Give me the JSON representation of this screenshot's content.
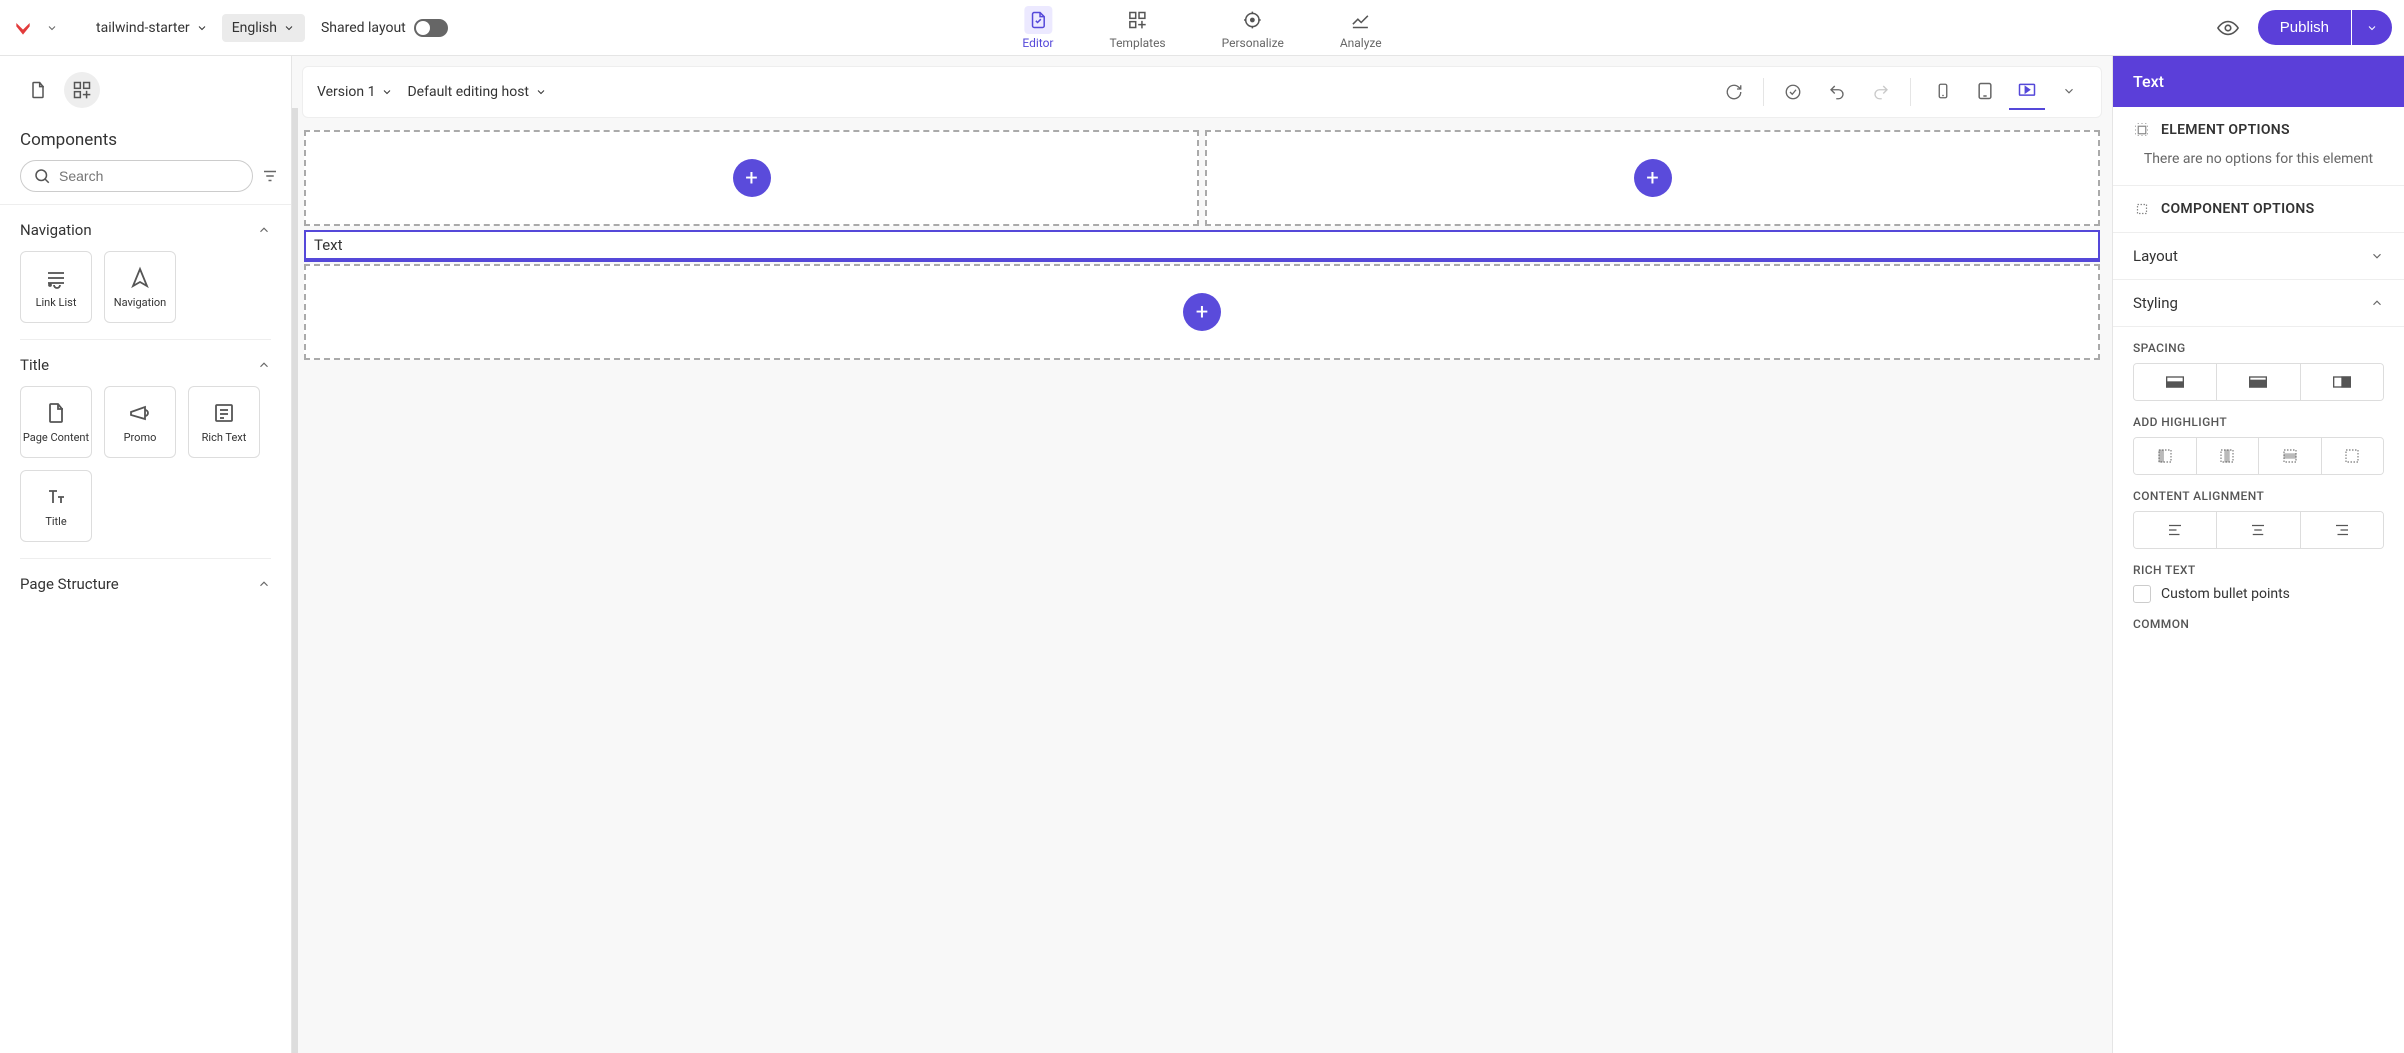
{
  "topbar": {
    "project": "tailwind-starter",
    "language": "English",
    "shared_label": "Shared layout",
    "nav": {
      "editor": "Editor",
      "templates": "Templates",
      "personalize": "Personalize",
      "analyze": "Analyze"
    },
    "publish": "Publish"
  },
  "left": {
    "title": "Components",
    "search_placeholder": "Search",
    "groups": {
      "navigation": {
        "title": "Navigation",
        "link_list": "Link List",
        "navigation": "Navigation"
      },
      "page_content": {
        "title": "Title",
        "page_content": "Page Content",
        "promo": "Promo",
        "rich_text": "Rich Text"
      },
      "page_structure": {
        "title": "Page Structure"
      }
    }
  },
  "canvas": {
    "version": "Version 1",
    "host": "Default editing host",
    "selected_text": "Text"
  },
  "right": {
    "header": "Text",
    "element_options": "ELEMENT OPTIONS",
    "element_empty": "There are no options for this element",
    "component_options": "COMPONENT OPTIONS",
    "layout": "Layout",
    "styling": "Styling",
    "spacing": "SPACING",
    "add_highlight": "ADD HIGHLIGHT",
    "content_alignment": "CONTENT ALIGNMENT",
    "rich_text": "RICH TEXT",
    "custom_bullets": "Custom bullet points",
    "common": "COMMON"
  }
}
